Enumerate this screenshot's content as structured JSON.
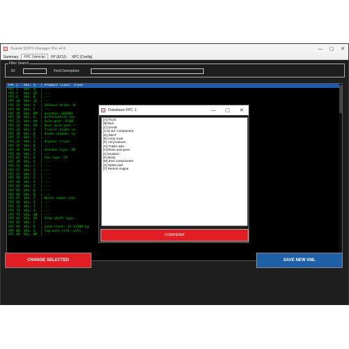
{
  "window": {
    "title": "Scania SOPS Manager Pro v4.6",
    "controls": [
      "—",
      "▢",
      "✕"
    ]
  },
  "tabs": [
    "Summary",
    "FPC (Vehicle)",
    "FP (ECU)",
    "XPC (Config)"
  ],
  "filter": {
    "legend": "Filter Search",
    "id_label": "ID:",
    "desc_label": "Find Description:",
    "id_value": "",
    "desc_value": ""
  },
  "rows": [
    [
      "FPC 1",
      "VAL: A",
      "| Product class: Truck"
    ],
    [
      "FPC 2",
      "VAL: H",
      "| ---"
    ],
    [
      "FPC 5",
      "VAL: ZZ",
      "| ---"
    ],
    [
      "FPC 8",
      "VAL: B",
      "| ---"
    ],
    [
      "FPC 10",
      "VAL: ZZ",
      "| ---"
    ],
    [
      "FPC 11",
      "VAL: A",
      "| Exhaust brake: W"
    ],
    [
      "FPC 18",
      "VAL: F",
      "| ---"
    ],
    [
      "FPC 19",
      "VAL: BM",
      "| Gearbox: GRSO91"
    ],
    [
      "FPC 20",
      "VAL: A",
      "| Differential loc"
    ],
    [
      "FPC 21",
      "VAL: AK",
      "| Axle gear: R780"
    ],
    [
      "FPC 22",
      "VAL: DA",
      "| Rear axle gear r"
    ],
    [
      "FPC 24",
      "VAL: A",
      "| Trailer brake co"
    ],
    [
      "FPC 30",
      "VAL: B",
      "| Brake chamber ty"
    ],
    [
      "FPC 31",
      "VAL: Z",
      "| ---"
    ],
    [
      "FPC 32",
      "VAL: S",
      "| Engine: truck"
    ],
    [
      "FPC 35",
      "VAL: B",
      "| ---"
    ],
    [
      "FPC 39",
      "VAL: A",
      "| Gearbox type: AM"
    ],
    [
      "FPC 41",
      "VAL: Z",
      "| ---"
    ],
    [
      "FPC 42",
      "VAL: H",
      "| Cab type: CR"
    ],
    [
      "FPC 49",
      "VAL: A",
      "| ---"
    ],
    [
      "FPC 53",
      "VAL: C",
      "| ---"
    ],
    [
      "FPC 55",
      "VAL: Z",
      "| ---"
    ],
    [
      "FPC 57",
      "VAL: Z",
      "| ---"
    ],
    [
      "FPC 58",
      "VAL: E",
      "| ---"
    ],
    [
      "FPC 60",
      "VAL: A",
      "| ---"
    ],
    [
      "FPC 61",
      "VAL: Z",
      "| ---"
    ],
    [
      "FPC 63",
      "VAL: B",
      "| ---"
    ],
    [
      "FPC 66",
      "VAL: B",
      "| ---"
    ],
    [
      "FPC 67",
      "VAL: Z",
      "| White smoke limi"
    ],
    [
      "FPC 68",
      "VAL: A",
      "| ---"
    ],
    [
      "FPC 73",
      "VAL: T",
      "| ---"
    ],
    [
      "FPC 74",
      "VAL: Z",
      "| ---"
    ],
    [
      "FPC 77",
      "VAL: AB",
      "| ---"
    ],
    [
      "FPC 82",
      "VAL: EA",
      "| Prop.shaft type:"
    ],
    [
      "FPC 83",
      "VAL: F",
      "| ---"
    ],
    [
      "FPC 84",
      "VAL: D",
      "| Load limit: at 11500 kg"
    ],
    [
      "FPC 86",
      "VAL: A",
      "| Tag axle lift: with"
    ],
    [
      "FPC 89",
      "VAL: BP",
      "| ---"
    ]
  ],
  "buttons": {
    "change": "CHANGE SELECTED",
    "save": "SAVE NEW XML"
  },
  "dialog": {
    "title": "Database FPC 1",
    "controls": [
      "—",
      "▢",
      "✕"
    ],
    "items": [
      "[A] Truck",
      "[B] Bus",
      "[C] SAAB",
      "[CU] Ind. Component",
      "[D] SBAT",
      "[E] Army truck",
      "[F] I M products",
      "[G] Trailer axle",
      "[H] Rims and tyres",
      "[I] Gearbox",
      "[K] Body",
      "[M] ESA components",
      "[S] Spare part",
      "[T] Remov engine"
    ],
    "confirm": "CONFERM"
  },
  "colors": {
    "list_text": "#00e000",
    "selected": "#1e5aa8",
    "red": "#e01e24",
    "blue": "#1e5fa8"
  }
}
